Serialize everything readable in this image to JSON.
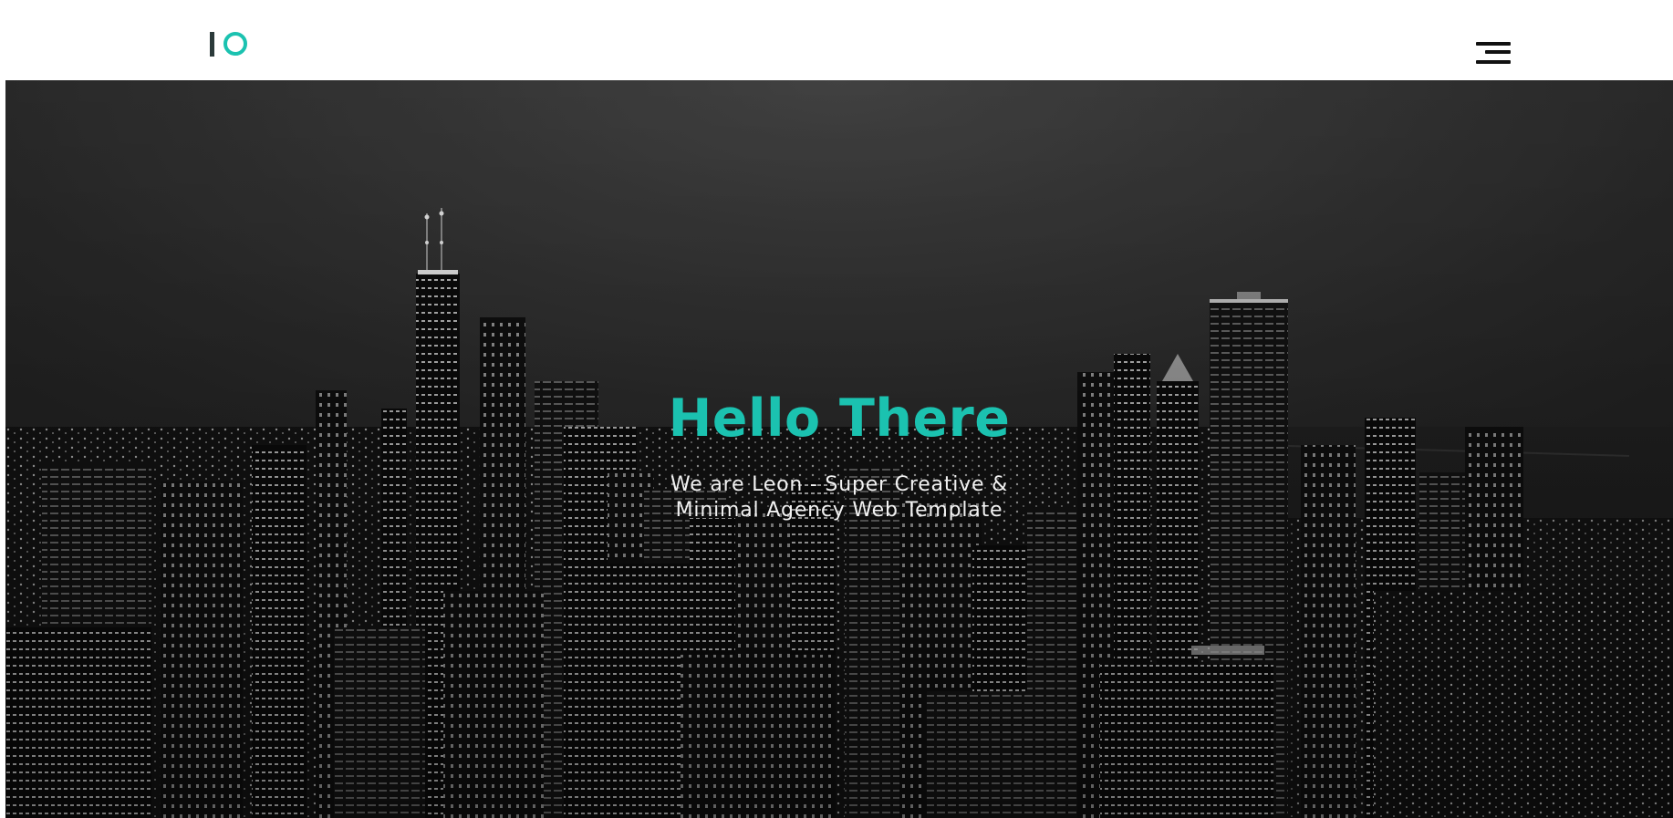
{
  "header": {
    "logo_alt": "IO logo",
    "menu_icon": "hamburger-menu-icon"
  },
  "hero": {
    "title": "Hello There",
    "subtitle_line1": "We are Leon - Super Creative &",
    "subtitle_line2": "Minimal Agency Web Template",
    "background": "night city skyline"
  },
  "colors": {
    "accent": "#1bc2b0",
    "header_bg": "#ffffff",
    "menu_icon": "#111111",
    "subtitle_text": "#f2f2f2"
  }
}
